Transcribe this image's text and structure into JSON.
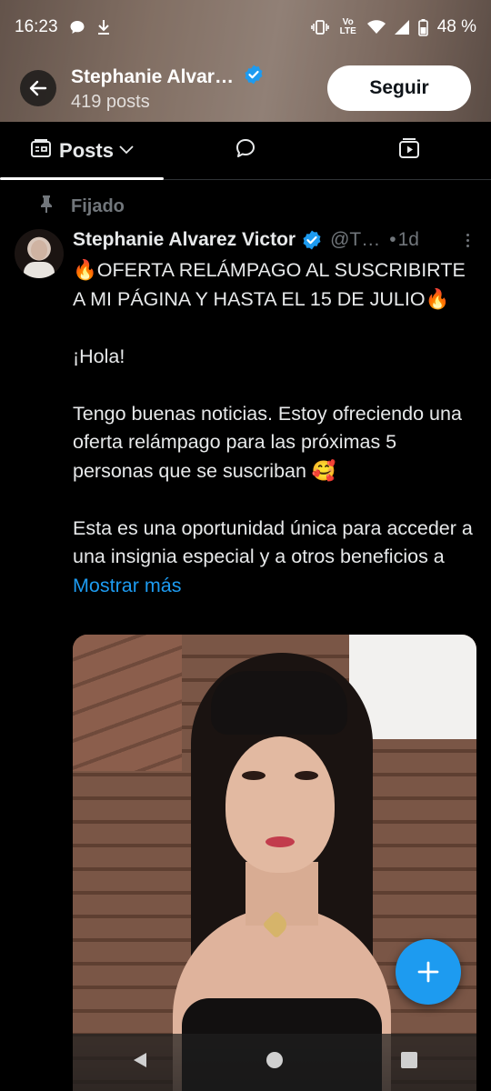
{
  "status_bar": {
    "time": "16:23",
    "battery": "48 %",
    "icons": [
      "chat-bubble-icon",
      "download-icon",
      "vibrate-icon",
      "volte-icon",
      "wifi-icon",
      "signal-icon",
      "battery-icon"
    ],
    "volte_text": "Vo LTE"
  },
  "profile": {
    "name": "Stephanie Alvar…",
    "posts_count": "419 posts",
    "follow_label": "Seguir"
  },
  "tabs": {
    "posts_label": "Posts",
    "items": [
      "posts",
      "replies-icon",
      "media-icon"
    ]
  },
  "pinned": {
    "label": "Fijado"
  },
  "post": {
    "author": "Stephanie Alvarez Victor",
    "handle": "@T…",
    "dot": "•",
    "time": "1d",
    "line1": "🔥OFERTA RELÁMPAGO AL SUSCRIBIRTE A MI PÁGINA Y HASTA EL 15 DE JULIO🔥",
    "line2": "¡Hola!",
    "line3": "Tengo buenas noticias. Estoy ofreciendo una oferta relámpago para las próximas 5 personas que se suscriban 🥰",
    "line4": "Esta es una oportunidad única para acceder a una insignia especial y a otros beneficios a ",
    "show_more": "Mostrar más"
  },
  "colors": {
    "accent": "#1d9bf0",
    "background": "#000000",
    "text": "#e7e9ea",
    "muted": "#71767b"
  }
}
